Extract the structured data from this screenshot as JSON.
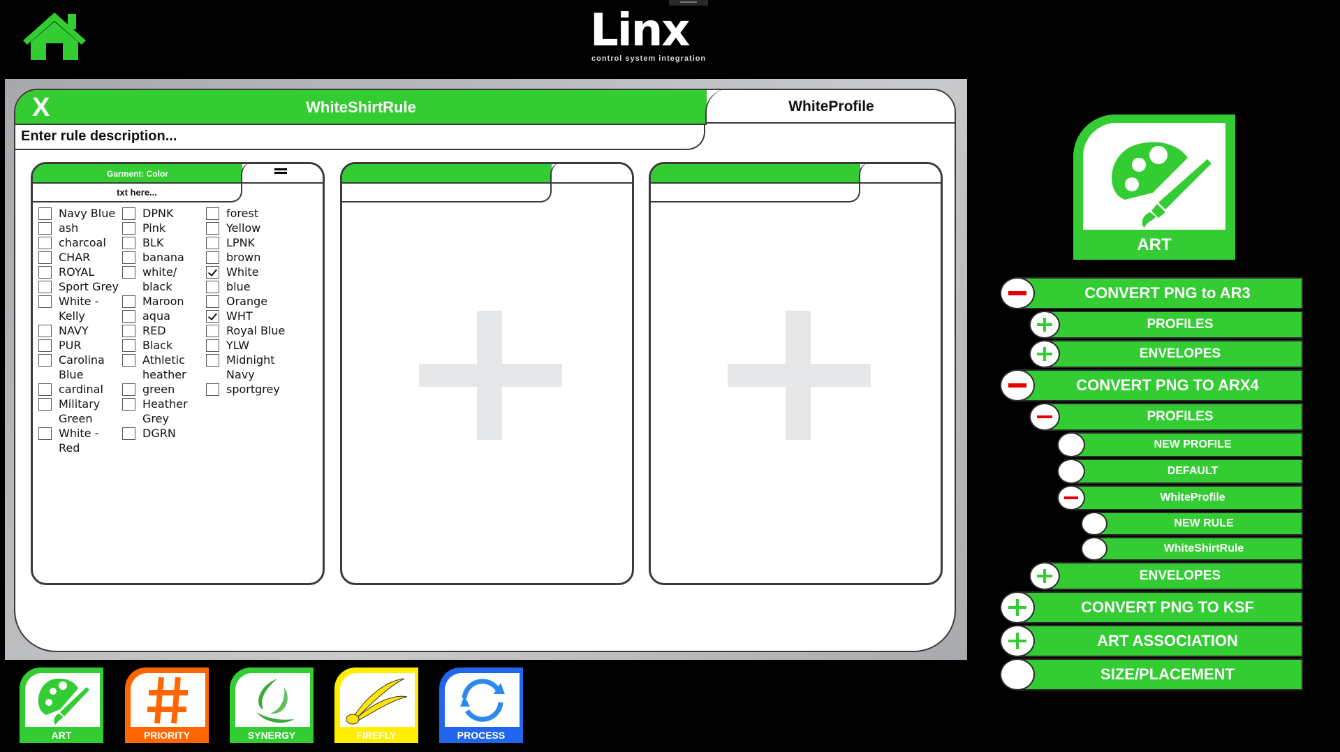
{
  "header": {
    "home_icon": "home-icon",
    "logo_text": "Linx",
    "logo_tagline": "control system integration"
  },
  "editor": {
    "close_label": "X",
    "rule_name": "WhiteShirtRule",
    "profile_name": "WhiteProfile",
    "description_placeholder": "Enter rule description..."
  },
  "panels": [
    {
      "title": "Garment: Color",
      "field_placeholder": "txt here...",
      "menu_icon": "hamburger-icon",
      "columns": [
        [
          {
            "label": "Navy Blue",
            "checked": false
          },
          {
            "label": "ash",
            "checked": false
          },
          {
            "label": "charcoal",
            "checked": false
          },
          {
            "label": "CHAR",
            "checked": false
          },
          {
            "label": "ROYAL",
            "checked": false
          },
          {
            "label": "Sport Grey",
            "checked": false
          },
          {
            "label": "White - Kelly",
            "checked": false
          },
          {
            "label": "NAVY",
            "checked": false
          },
          {
            "label": "PUR",
            "checked": false
          },
          {
            "label": "Carolina Blue",
            "checked": false
          },
          {
            "label": "cardinal",
            "checked": false
          },
          {
            "label": "Military Green",
            "checked": false
          },
          {
            "label": "White - Red",
            "checked": false
          }
        ],
        [
          {
            "label": "DPNK",
            "checked": false
          },
          {
            "label": "Pink",
            "checked": false
          },
          {
            "label": "BLK",
            "checked": false
          },
          {
            "label": "banana",
            "checked": false
          },
          {
            "label": "white/ black",
            "checked": false
          },
          {
            "label": "Maroon",
            "checked": false
          },
          {
            "label": "aqua",
            "checked": false
          },
          {
            "label": "RED",
            "checked": false
          },
          {
            "label": "Black",
            "checked": false
          },
          {
            "label": "Athletic heather",
            "checked": false
          },
          {
            "label": "green",
            "checked": false
          },
          {
            "label": "Heather Grey",
            "checked": false
          },
          {
            "label": "DGRN",
            "checked": false
          }
        ],
        [
          {
            "label": "forest",
            "checked": false
          },
          {
            "label": "Yellow",
            "checked": false
          },
          {
            "label": "LPNK",
            "checked": false
          },
          {
            "label": "brown",
            "checked": false
          },
          {
            "label": "White",
            "checked": true
          },
          {
            "label": "blue",
            "checked": false
          },
          {
            "label": "Orange",
            "checked": false
          },
          {
            "label": "WHT",
            "checked": true
          },
          {
            "label": "Royal Blue",
            "checked": false
          },
          {
            "label": "YLW",
            "checked": false
          },
          {
            "label": "Midnight Navy",
            "checked": false
          },
          {
            "label": "sportgrey",
            "checked": false
          }
        ]
      ]
    },
    {
      "title": "",
      "field_placeholder": "",
      "add_icon": "plus-icon"
    },
    {
      "title": "",
      "field_placeholder": "",
      "add_icon": "plus-icon"
    }
  ],
  "sidebar": {
    "tile_label": "ART",
    "tile_icon": "palette-icon",
    "tree": [
      {
        "label": "CONVERT PNG to AR3",
        "state": "expanded",
        "level": 0
      },
      {
        "label": "PROFILES",
        "state": "collapsed",
        "level": 1
      },
      {
        "label": "ENVELOPES",
        "state": "collapsed",
        "level": 1
      },
      {
        "label": "CONVERT PNG TO ARX4",
        "state": "expanded",
        "level": 0
      },
      {
        "label": "PROFILES",
        "state": "expanded",
        "level": 1
      },
      {
        "label": "NEW PROFILE",
        "state": "leaf",
        "level": 2
      },
      {
        "label": "DEFAULT",
        "state": "leaf",
        "level": 2
      },
      {
        "label": "WhiteProfile",
        "state": "expanded",
        "level": 2
      },
      {
        "label": "NEW RULE",
        "state": "leaf",
        "level": 3
      },
      {
        "label": "WhiteShirtRule",
        "state": "leaf",
        "level": 3
      },
      {
        "label": "ENVELOPES",
        "state": "collapsed",
        "level": 1
      },
      {
        "label": "CONVERT PNG TO KSF",
        "state": "collapsed",
        "level": 0
      },
      {
        "label": "ART ASSOCIATION",
        "state": "collapsed",
        "level": 0
      },
      {
        "label": "SIZE/PLACEMENT",
        "state": "leaf",
        "level": 0
      }
    ]
  },
  "dock": [
    {
      "label": "ART",
      "icon": "palette-icon",
      "color": "#33cc33"
    },
    {
      "label": "PRIORITY",
      "icon": "hash-icon",
      "color": "#ff6600"
    },
    {
      "label": "SYNERGY",
      "icon": "swirl-icon",
      "color": "#33cc33"
    },
    {
      "label": "FIREFLY",
      "icon": "firefly-icon",
      "color": "#ffee00"
    },
    {
      "label": "PROCESS",
      "icon": "refresh-icon",
      "color": "#2266ee"
    }
  ],
  "colors": {
    "accent_green": "#33cc33",
    "collapse_red": "#e60000",
    "workspace_grey": "#b4b5b8"
  }
}
